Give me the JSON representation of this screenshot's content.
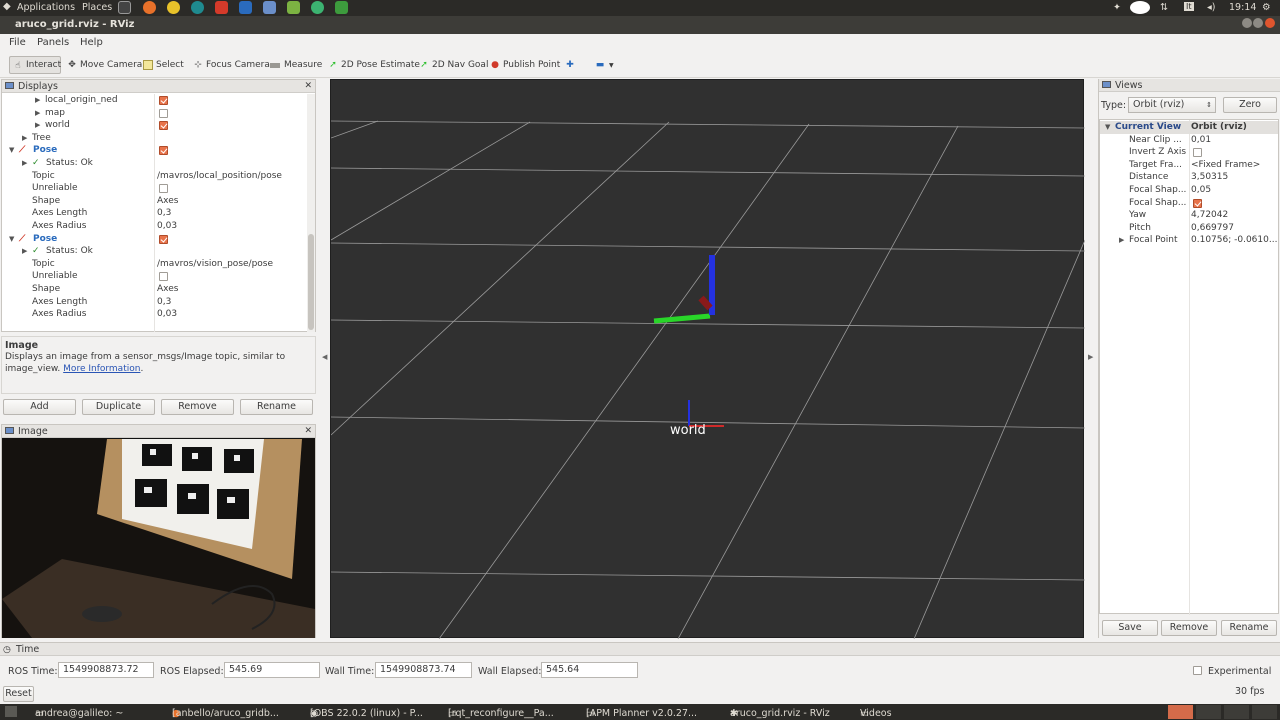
{
  "topbar": {
    "applications": "Applications",
    "places": "Places",
    "clock": "19:14"
  },
  "window_title": "aruco_grid.rviz - RViz",
  "menu": [
    "File",
    "Panels",
    "Help"
  ],
  "toolbar": [
    "Interact",
    "Move Camera",
    "Select",
    "Focus Camera",
    "Measure",
    "2D Pose Estimate",
    "2D Nav Goal",
    "Publish Point"
  ],
  "displays": {
    "title": "Displays",
    "rows": [
      {
        "label": "local_origin_ned"
      },
      {
        "label": "map"
      },
      {
        "label": "world"
      },
      {
        "label": "Tree"
      },
      {
        "label": "Pose"
      },
      {
        "label": "Status: Ok"
      },
      {
        "label": "Topic",
        "value": "/mavros/local_position/pose"
      },
      {
        "label": "Unreliable"
      },
      {
        "label": "Shape",
        "value": "Axes"
      },
      {
        "label": "Axes Length",
        "value": "0,3"
      },
      {
        "label": "Axes Radius",
        "value": "0,03"
      },
      {
        "label": "Pose"
      },
      {
        "label": "Status: Ok"
      },
      {
        "label": "Topic",
        "value": "/mavros/vision_pose/pose"
      },
      {
        "label": "Unreliable"
      },
      {
        "label": "Shape",
        "value": "Axes"
      },
      {
        "label": "Axes Length",
        "value": "0,3"
      },
      {
        "label": "Axes Radius",
        "value": "0,03"
      }
    ],
    "desc_title": "Image",
    "desc_text": "Displays an image from a sensor_msgs/Image topic, similar to image_view.",
    "desc_link": "More Information",
    "buttons": {
      "add": "Add",
      "duplicate": "Duplicate",
      "remove": "Remove",
      "rename": "Rename"
    }
  },
  "image_panel": {
    "title": "Image"
  },
  "viewport": {
    "frame_label": "world"
  },
  "views": {
    "title": "Views",
    "type_label": "Type:",
    "type_value": "Orbit (rviz)",
    "zero": "Zero",
    "header": {
      "name": "Current View",
      "value": "Orbit (rviz)"
    },
    "props": [
      {
        "k": "Near Clip ...",
        "v": "0,01"
      },
      {
        "k": "Invert Z Axis",
        "v": ""
      },
      {
        "k": "Target Fra...",
        "v": "<Fixed Frame>"
      },
      {
        "k": "Distance",
        "v": "3,50315"
      },
      {
        "k": "Focal Shap...",
        "v": "0,05"
      },
      {
        "k": "Focal Shap...",
        "v": ""
      },
      {
        "k": "Yaw",
        "v": "4,72042"
      },
      {
        "k": "Pitch",
        "v": "0,669797"
      },
      {
        "k": "Focal Point",
        "v": "0.10756; -0.0610..."
      }
    ],
    "buttons": {
      "save": "Save",
      "remove": "Remove",
      "rename": "Rename"
    }
  },
  "time": {
    "title": "Time",
    "ros_time_label": "ROS Time:",
    "ros_time": "1549908873.72",
    "ros_elapsed_label": "ROS Elapsed:",
    "ros_elapsed": "545.69",
    "wall_time_label": "Wall Time:",
    "wall_time": "1549908873.74",
    "wall_elapsed_label": "Wall Elapsed:",
    "wall_elapsed": "545.64",
    "experimental": "Experimental",
    "reset": "Reset",
    "fps": "30 fps"
  },
  "taskbar": [
    "andrea@galileo: ~",
    "[anbello/aruco_gridb...",
    "[OBS 22.0.2 (linux) - P...",
    "[rqt_reconfigure__Pa...",
    "[APM Planner v2.0.27...",
    "aruco_grid.rviz - RViz",
    "Videos"
  ]
}
